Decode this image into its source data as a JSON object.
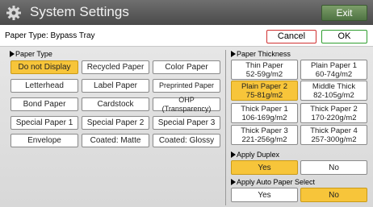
{
  "header": {
    "title": "System Settings",
    "exit_label": "Exit"
  },
  "infobar": {
    "paper_type": "Paper Type: Bypass Tray",
    "cancel_label": "Cancel",
    "ok_label": "OK"
  },
  "paper_type": {
    "label": "Paper Type",
    "options": [
      {
        "label": "Do not Display",
        "selected": true
      },
      {
        "label": "Recycled Paper",
        "selected": false
      },
      {
        "label": "Color Paper",
        "selected": false
      },
      {
        "label": "Letterhead",
        "selected": false
      },
      {
        "label": "Label Paper",
        "selected": false
      },
      {
        "label": "Preprinted Paper",
        "selected": false
      },
      {
        "label": "Bond Paper",
        "selected": false
      },
      {
        "label": "Cardstock",
        "selected": false
      },
      {
        "label": "OHP (Transparency)",
        "selected": false
      },
      {
        "label": "Special Paper 1",
        "selected": false
      },
      {
        "label": "Special Paper 2",
        "selected": false
      },
      {
        "label": "Special Paper 3",
        "selected": false
      },
      {
        "label": "Envelope",
        "selected": false
      },
      {
        "label": "Coated: Matte",
        "selected": false
      },
      {
        "label": "Coated: Glossy",
        "selected": false
      }
    ]
  },
  "paper_thickness": {
    "label": "Paper Thickness",
    "options": [
      {
        "name": "Thin Paper",
        "range": "52-59g/m2",
        "selected": false
      },
      {
        "name": "Plain Paper 1",
        "range": "60-74g/m2",
        "selected": false
      },
      {
        "name": "Plain Paper 2",
        "range": "75-81g/m2",
        "selected": true
      },
      {
        "name": "Middle Thick",
        "range": "82-105g/m2",
        "selected": false
      },
      {
        "name": "Thick Paper 1",
        "range": "106-169g/m2",
        "selected": false
      },
      {
        "name": "Thick Paper 2",
        "range": "170-220g/m2",
        "selected": false
      },
      {
        "name": "Thick Paper 3",
        "range": "221-256g/m2",
        "selected": false
      },
      {
        "name": "Thick Paper 4",
        "range": "257-300g/m2",
        "selected": false
      }
    ]
  },
  "apply_duplex": {
    "label": "Apply Duplex",
    "yes": "Yes",
    "no": "No",
    "value": "Yes"
  },
  "apply_auto": {
    "label": "Apply Auto Paper Select",
    "yes": "Yes",
    "no": "No",
    "value": "No"
  },
  "colors": {
    "selected": "#f7c53a",
    "exit": "#5e8450",
    "cancel_border": "#d03030",
    "ok_border": "#2f9e2f"
  },
  "icons": {
    "header": "gear-icon"
  }
}
